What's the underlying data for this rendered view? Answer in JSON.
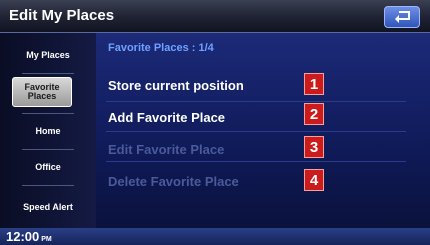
{
  "header": {
    "title": "Edit My Places",
    "back_icon": "back-arrow-icon"
  },
  "sidebar": {
    "items": [
      {
        "label": "My Places",
        "selected": false
      },
      {
        "label": "Favorite Places",
        "selected": true
      },
      {
        "label": "Home",
        "selected": false
      },
      {
        "label": "Office",
        "selected": false
      },
      {
        "label": "Speed Alert",
        "selected": false
      }
    ]
  },
  "main": {
    "subtitle": "Favorite Places : 1/4",
    "options": [
      {
        "label": "Store current position",
        "enabled": true,
        "badge": "1"
      },
      {
        "label": "Add Favorite Place",
        "enabled": true,
        "badge": "2"
      },
      {
        "label": "Edit Favorite Place",
        "enabled": false,
        "badge": "3"
      },
      {
        "label": "Delete Favorite Place",
        "enabled": false,
        "badge": "4"
      }
    ]
  },
  "status": {
    "time": "12:00",
    "ampm": "PM"
  },
  "colors": {
    "badge": "#cc1b1b",
    "accent": "#6fa0ff",
    "disabled": "#4a5a9a"
  }
}
